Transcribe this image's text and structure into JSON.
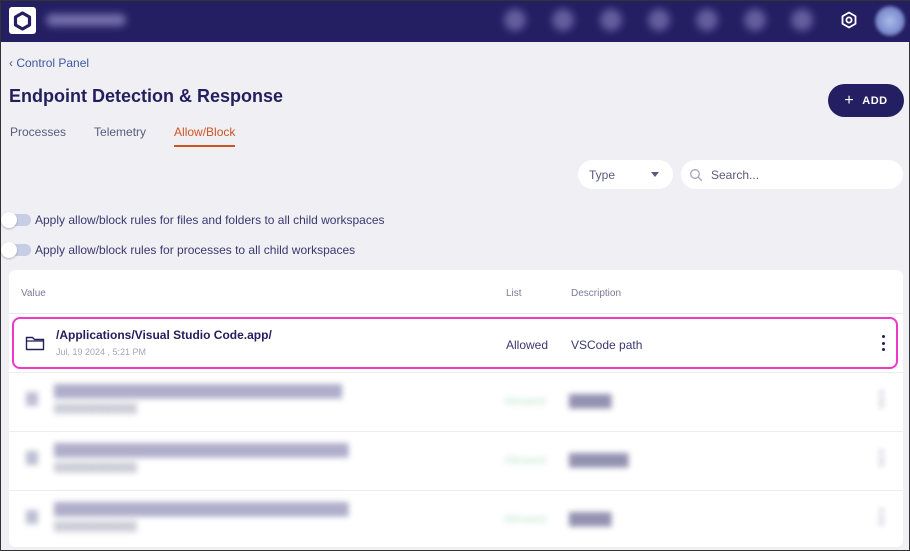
{
  "topbar": {
    "org_name": "Workspace name (blurred)",
    "nav_icons": [
      "search-icon",
      "nav-icon-2",
      "nav-icon-3",
      "alert-icon",
      "nav-icon-5",
      "nav-icon-6",
      "nav-icon-7"
    ],
    "settings_icon": "gear-icon",
    "avatar": "user-avatar"
  },
  "breadcrumb": {
    "chevron": "‹",
    "label": "Control Panel"
  },
  "page": {
    "title": "Endpoint Detection & Response",
    "add_button": {
      "icon": "+",
      "label": "ADD"
    }
  },
  "tabs": [
    {
      "label": "Processes",
      "active": false
    },
    {
      "label": "Telemetry",
      "active": false
    },
    {
      "label": "Allow/Block",
      "active": true
    }
  ],
  "filters": {
    "type_select": {
      "value": "Type"
    },
    "search": {
      "placeholder": "Search...",
      "value": ""
    }
  },
  "toggles": [
    {
      "label": "Apply allow/block rules for files and folders to all child workspaces",
      "on": false
    },
    {
      "label": "Apply allow/block rules for processes to all child workspaces",
      "on": false
    }
  ],
  "table": {
    "columns": [
      "Value",
      "List",
      "Description"
    ],
    "rows": [
      {
        "value": "/Applications/Visual Studio Code.app/",
        "date": "Jul, 19 2024 , 5:21 PM",
        "list": "Allowed",
        "description": "VSCode path",
        "selected": true,
        "blurred": false
      },
      {
        "value": "████████████████████████████████████████████",
        "date": "█████████████",
        "list": "Allowed",
        "description": "█████",
        "selected": false,
        "blurred": true
      },
      {
        "value": "█████████████████████████████████████████████",
        "date": "█████████████",
        "list": "Allowed",
        "description": "███████",
        "selected": false,
        "blurred": true
      },
      {
        "value": "█████████████████████████████████████████████",
        "date": "█████████████",
        "list": "Allowed",
        "description": "█████",
        "selected": false,
        "blurred": true
      }
    ]
  },
  "colors": {
    "brand": "#241e63",
    "active_tab": "#cc5522",
    "selection_outline": "#f038c8",
    "link": "#3c5aa0"
  }
}
